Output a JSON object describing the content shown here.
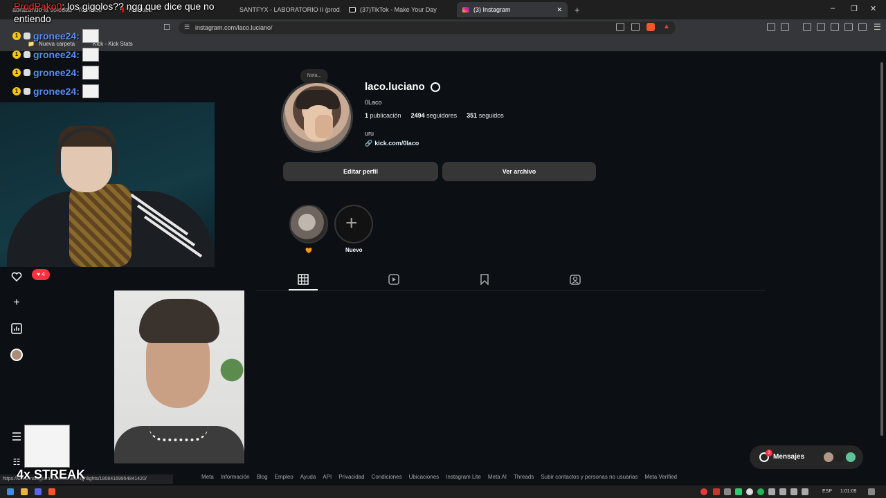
{
  "browser": {
    "tabs": [
      {
        "label": "abrazando la soledad - YouTube",
        "active": false
      },
      {
        "label": "YouTube",
        "active": false
      },
      {
        "label": "SANTFYX - LABORATORIO II (prod.q",
        "active": false
      },
      {
        "label": "(37)TikTok - Make Your Day",
        "active": false
      },
      {
        "label": "(3) Instagram",
        "active": true
      }
    ],
    "new_tab": "+",
    "close": "✕",
    "url": "instagram.com/laco.luciano/",
    "bookmarks": [
      "Nueva carpeta",
      "Kick - Kick Stats"
    ],
    "status_url": "https://www.instagram.com/stories/highlights/18084169954841420/"
  },
  "profile": {
    "note": "Nota...",
    "username": "laco.luciano",
    "full_name": "0Laco",
    "stats": {
      "posts_count": "1",
      "posts_label": "publicación",
      "followers_count": "2494",
      "followers_label": "seguidores",
      "following_count": "351",
      "following_label": "seguidos"
    },
    "bio": "uru",
    "link": "kick.com/0laco",
    "edit_button": "Editar perfil",
    "archive_button": "Ver archivo",
    "highlights": [
      {
        "label": "🧡"
      },
      {
        "label": "Nuevo"
      }
    ]
  },
  "sidebar": {
    "notifications_count": "4"
  },
  "footer": [
    "Meta",
    "Información",
    "Blog",
    "Empleo",
    "Ayuda",
    "API",
    "Privacidad",
    "Condiciones",
    "Ubicaciones",
    "Instagram Lite",
    "Meta AI",
    "Threads",
    "Subir contactos y personas no usuarias",
    "Meta Verified"
  ],
  "messages": {
    "label": "Mensajes",
    "badge": "3"
  },
  "taskbar": {
    "lang": "ESP",
    "time": "1:01:09"
  },
  "overlay": {
    "top_chat_user": "ProdPako0",
    "top_chat_text": ": los gigolos?? ngg que dice que no entiendo",
    "chat_user": "gronee24:",
    "badge_num": "1",
    "streak": "4x STREAK"
  },
  "colors": {
    "background": "#0c1014",
    "button": "#363636",
    "accent_red": "#ff3040",
    "chat_user": "#5b8ef5"
  }
}
